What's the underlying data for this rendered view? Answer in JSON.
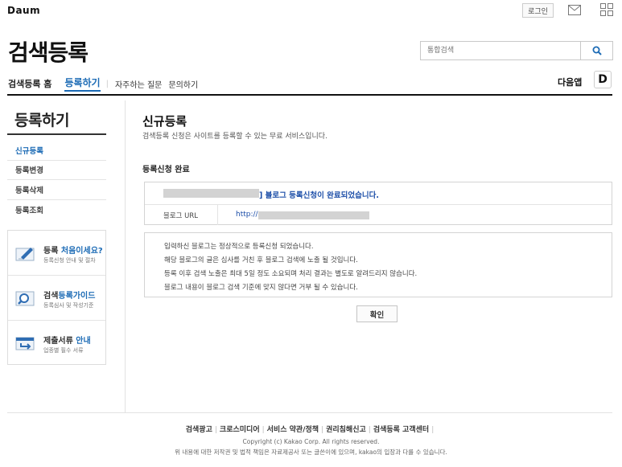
{
  "brand": {
    "logo": "Daum"
  },
  "topbar": {
    "login_label": "로그인"
  },
  "header": {
    "title": "검색등록",
    "search_placeholder": "통합검색"
  },
  "gnb": {
    "home": "검색등록 홈",
    "active": "등록하기",
    "separator": "|",
    "items": [
      "자주하는 질문",
      "문의하기"
    ],
    "app_label": "다음앱",
    "app_badge": "D"
  },
  "sidebar": {
    "title": "등록하기",
    "menu": [
      "신규등록",
      "등록변경",
      "등록삭제",
      "등록조회"
    ],
    "active_index": 0,
    "promos": [
      {
        "title_plain": "등록 ",
        "title_accent": "처음이세요?",
        "subtitle": "등록신청 안내 및 절차",
        "icon": "pencil-doc-icon"
      },
      {
        "title_plain": "검색",
        "title_accent": "등록가이드",
        "subtitle": "등록심사 및 작성기준",
        "icon": "magnifier-doc-icon"
      },
      {
        "title_plain": "제출서류 ",
        "title_accent": "안내",
        "subtitle": "업종별 필수 서류",
        "icon": "tray-arrow-icon"
      }
    ]
  },
  "content": {
    "title": "신규등록",
    "description": "검색등록 신청은 사이트를 등록할 수 있는 무료 서비스입니다.",
    "subtitle": "등록신청 완료",
    "result": {
      "message": "] 블로그 등록신청이 완료되었습니다.",
      "url_label": "블로그 URL",
      "url_prefix": "http://"
    },
    "notice_lines": [
      "입력하신 블로그는 정상적으로 등록신청 되었습니다.",
      "해당 블로그의 글은 심사를 거친 후 블로그 검색에 노출 될 것입니다.",
      "등록 이후 검색 노출은 최대 5일 정도 소요되며 처리 결과는 별도로 알려드리지 않습니다.",
      "블로그 내용이 블로그 검색 기준에 맞지 않다면 거부 될 수 있습니다."
    ],
    "confirm_label": "확인"
  },
  "footer": {
    "links": [
      "검색광고",
      "크로스미디어",
      "서비스 약관/정책",
      "권리침해신고",
      "검색등록 고객센터"
    ],
    "separator": "|",
    "copyright": "Copyright (c) Kakao Corp. All rights reserved.",
    "disclaimer": "위 내용에 대한 저작권 및 법적 책임은 자료제공사 또는 글쓴이에 있으며, kakao의 입장과 다를 수 있습니다."
  },
  "colors": {
    "accent": "#1c6bb5",
    "link_dark": "#1c4ea8",
    "rule": "#111111"
  }
}
